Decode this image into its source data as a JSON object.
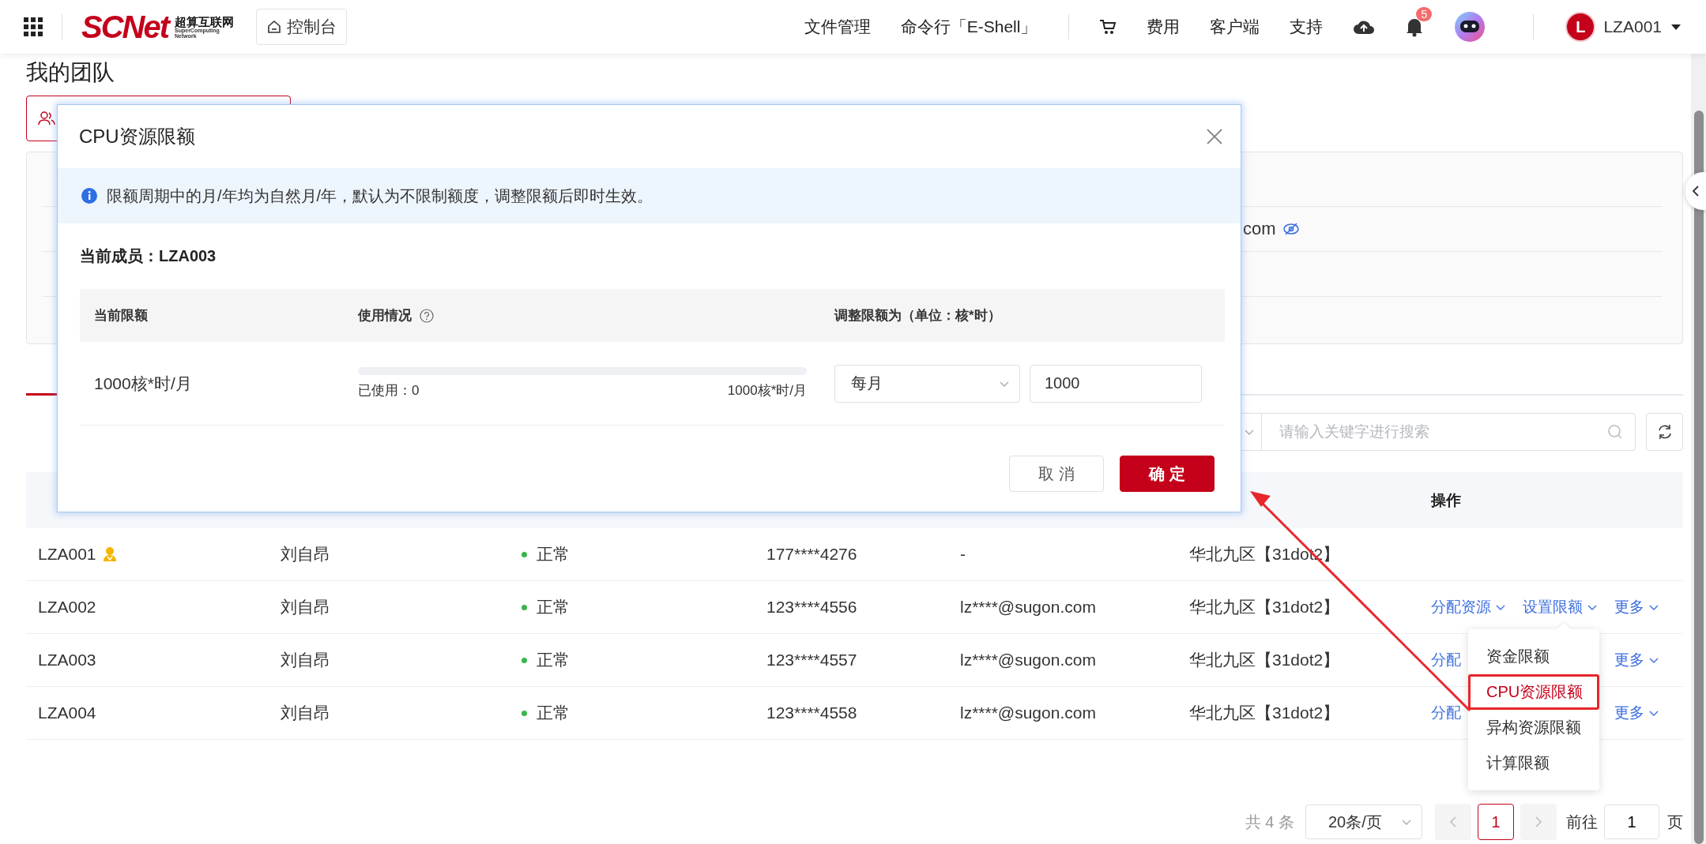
{
  "header": {
    "logo": {
      "wordmark": "SCNet",
      "name_cn": "超算互联网",
      "name_en": [
        "SuperComputing",
        "Network"
      ]
    },
    "console_button": "控制台",
    "nav": [
      "文件管理",
      "命令行「E-Shell」"
    ],
    "links": [
      "费用",
      "客户端",
      "支持"
    ],
    "notification_count": "5",
    "user": {
      "initial": "L",
      "name": "LZA001"
    }
  },
  "page": {
    "title": "我的团队",
    "info_fragment": "com",
    "search": {
      "placeholder": "请输入关键字进行搜索"
    },
    "table": {
      "operations_header": "操作",
      "rows": [
        {
          "username": "LZA001",
          "owner": true,
          "name": "刘自昂",
          "status": "正常",
          "phone": "177****4276",
          "email": "-",
          "region": "华北九区【31dot2】",
          "actions": []
        },
        {
          "username": "LZA002",
          "owner": false,
          "name": "刘自昂",
          "status": "正常",
          "phone": "123****4556",
          "email": "lz****@sugon.com",
          "region": "华北九区【31dot2】",
          "actions": [
            {
              "label": "分配资源",
              "has_menu": true
            },
            {
              "label": "设置限额",
              "has_menu": true
            },
            {
              "label": "更多",
              "has_menu": true
            }
          ]
        },
        {
          "username": "LZA003",
          "owner": false,
          "name": "刘自昂",
          "status": "正常",
          "phone": "123****4557",
          "email": "lz****@sugon.com",
          "region": "华北九区【31dot2】",
          "actions": [
            {
              "label": "分配",
              "has_menu": false
            },
            {
              "label": "更多",
              "has_menu": true
            }
          ]
        },
        {
          "username": "LZA004",
          "owner": false,
          "name": "刘自昂",
          "status": "正常",
          "phone": "123****4558",
          "email": "lz****@sugon.com",
          "region": "华北九区【31dot2】",
          "actions": [
            {
              "label": "分配",
              "has_menu": false
            },
            {
              "label": "更多",
              "has_menu": true
            }
          ]
        }
      ]
    },
    "action_menu": {
      "items": [
        {
          "label": "资金限额",
          "selected": false
        },
        {
          "label": "CPU资源限额",
          "selected": true
        },
        {
          "label": "异构资源限额",
          "selected": false
        },
        {
          "label": "计算限额",
          "selected": false
        }
      ]
    },
    "pagination": {
      "total": "共 4 条",
      "page_size": "20条/页",
      "pages": [
        {
          "label": "1",
          "selected": true
        }
      ],
      "goto_label": "前往",
      "goto_value": "1",
      "page_suffix": "页"
    }
  },
  "modal": {
    "title": "CPU资源限额",
    "notice": "限额周期中的月/年均为自然月/年，默认为不限制额度，调整限额后即时生效。",
    "member": "当前成员：LZA003",
    "columns": [
      "当前限额",
      "使用情况",
      "调整限额为（单位：核*时）"
    ],
    "row": {
      "current": "1000核*时/月",
      "usage": {
        "level": 0,
        "used": "已使用：0",
        "total": "1000核*时/月"
      },
      "period": "每月",
      "amount": "1000"
    },
    "buttons": [
      {
        "label": "取 消",
        "kind": "secondary"
      },
      {
        "label": "确 定",
        "kind": "primary"
      }
    ]
  }
}
